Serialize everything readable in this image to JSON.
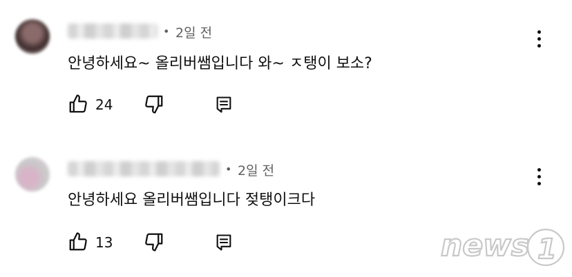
{
  "comments": [
    {
      "time": "2일 전",
      "dot": "•",
      "text": "안녕하세요~ 올리버쌤입니다 와~ ㅈ탱이 보소?",
      "likes": "24",
      "avatar_colors": [
        "#3b2a2a",
        "#8a6a6a",
        "#c9b9b9"
      ]
    },
    {
      "time": "2일 전",
      "dot": "•",
      "text": "안녕하세요 올리버쌤입니다 젖탱이크다",
      "likes": "13",
      "avatar_colors": [
        "#d8b4c8",
        "#c9c9c9",
        "#e6d4de"
      ]
    }
  ],
  "icons": {
    "like": "thumbs-up-icon",
    "dislike": "thumbs-down-icon",
    "reply": "reply-icon",
    "more": "more-vertical-icon"
  },
  "watermark": {
    "text": "news",
    "number": "1"
  }
}
